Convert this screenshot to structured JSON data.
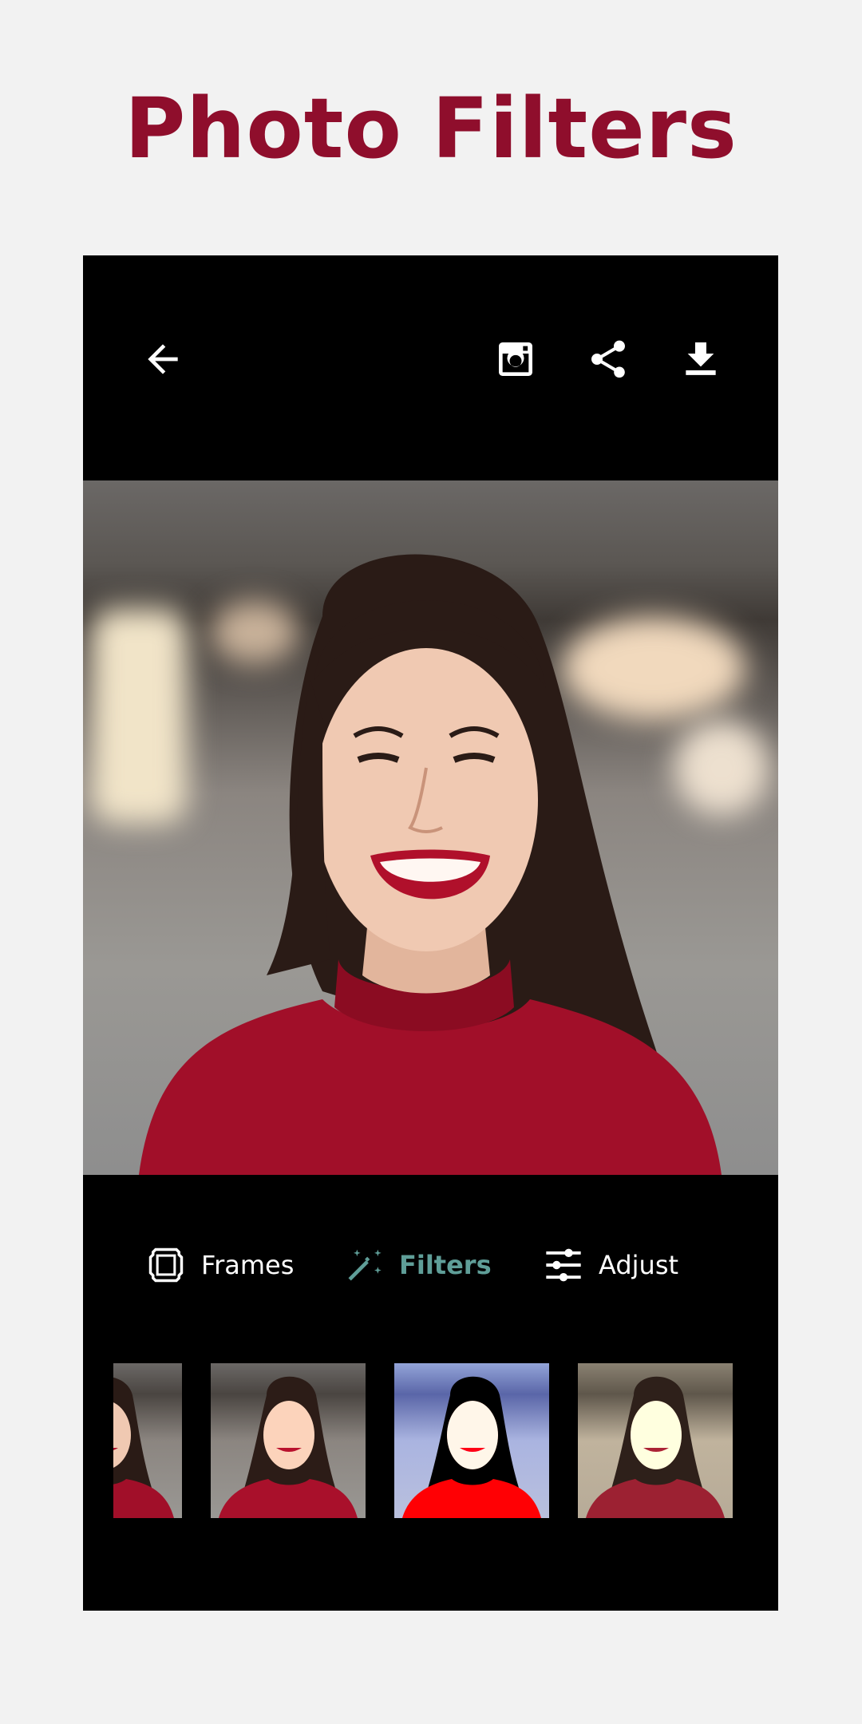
{
  "header": {
    "title": "Photo Filters"
  },
  "toolbar": {
    "back_icon": "arrow-left-icon",
    "actions": [
      "instagram-icon",
      "share-icon",
      "download-icon"
    ]
  },
  "tabs": [
    {
      "label": "Frames",
      "icon": "frame-icon",
      "active": false
    },
    {
      "label": "Filters",
      "icon": "magic-wand-icon",
      "active": true
    },
    {
      "label": "Adjust",
      "icon": "sliders-icon",
      "active": false
    }
  ],
  "colors": {
    "title": "#8f0e2c",
    "active_tab": "#5f9e98",
    "device_bg": "#000000",
    "page_bg": "#f2f2f2"
  }
}
